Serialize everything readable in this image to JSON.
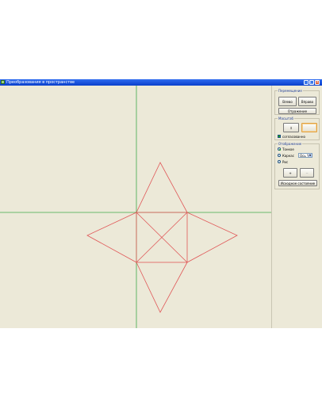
{
  "window": {
    "title": "Преобразования в пространстве",
    "controls": {
      "minimize": "_",
      "maximize": "□",
      "close": "×"
    }
  },
  "panel": {
    "move_group": {
      "label": "Перемещение",
      "left_button": "Влево",
      "right_button": "Вправо",
      "reflect_button": "Отражение"
    },
    "scale_group": {
      "label": "Масштаб",
      "scale_button": "↕",
      "scale_button2": "",
      "checkbox_label": "согласованно",
      "checkbox_checked": true
    },
    "display_group": {
      "label": "Отображение",
      "options": [
        "Тонкое",
        "Каркас",
        "Рис"
      ],
      "selected_option": 0,
      "select_value": "Ось Y",
      "button_a": "+",
      "button_b": "−",
      "reset_button": "Исходное состояние"
    }
  },
  "colors": {
    "figure": "#e05858",
    "axes": "#3fa84a",
    "background": "#ece9d8",
    "titlebar": "#0a3fcb"
  }
}
